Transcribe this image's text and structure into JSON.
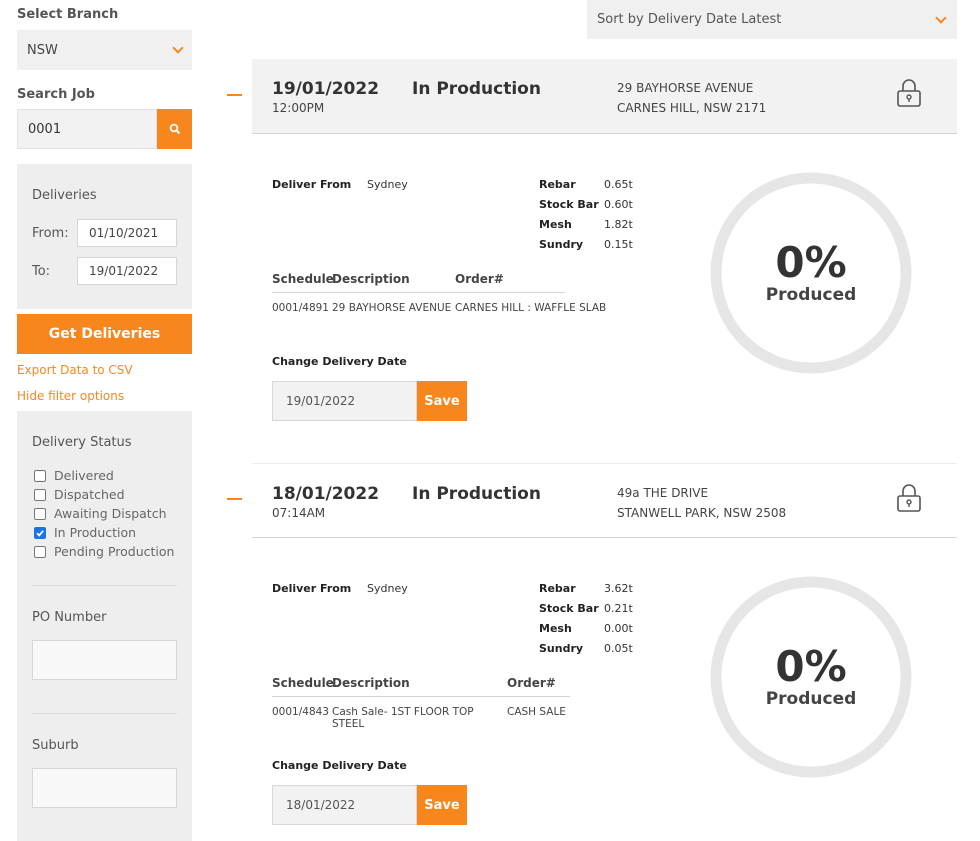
{
  "filters": {
    "branch_label": "Select Branch",
    "branch_value": "NSW",
    "search_label": "Search Job",
    "search_value": "0001",
    "deliveries_title": "Deliveries",
    "from_label": "From:",
    "from_value": "01/10/2021",
    "to_label": "To:",
    "to_value": "19/01/2022",
    "get_button": "Get Deliveries",
    "export_link": "Export Data to CSV",
    "hide_link": "Hide filter options",
    "status_title": "Delivery Status",
    "statuses": [
      {
        "label": "Delivered",
        "checked": false
      },
      {
        "label": "Dispatched",
        "checked": false
      },
      {
        "label": "Awaiting Dispatch",
        "checked": false
      },
      {
        "label": "In Production",
        "checked": true
      },
      {
        "label": "Pending Production",
        "checked": false
      }
    ],
    "po_label": "PO Number",
    "suburb_label": "Suburb"
  },
  "sort": {
    "label": "Sort by Delivery Date Latest"
  },
  "labels": {
    "deliver_from": "Deliver From",
    "schedule": "Schedule",
    "description": "Description",
    "order": "Order#",
    "change_date": "Change Delivery Date",
    "save": "Save",
    "produced": "Produced"
  },
  "jobs": [
    {
      "date": "19/01/2022",
      "time": "12:00PM",
      "status": "In Production",
      "address1": "29 BAYHORSE AVENUE",
      "address2": "CARNES HILL, NSW 2171",
      "deliver_from": "Sydney",
      "materials": [
        {
          "name": "Rebar",
          "value": "0.65t"
        },
        {
          "name": "Stock Bar",
          "value": "0.60t"
        },
        {
          "name": "Mesh",
          "value": "1.82t"
        },
        {
          "name": "Sundry",
          "value": "0.15t"
        }
      ],
      "schedule": "0001/4891",
      "description": "29 BAYHORSE AVENUE",
      "order": "CARNES HILL : WAFFLE SLAB",
      "delivery_date": "19/01/2022",
      "percent": "0%",
      "produced_fraction": 0
    },
    {
      "date": "18/01/2022",
      "time": "07:14AM",
      "status": "In Production",
      "address1": "49a THE DRIVE",
      "address2": "STANWELL PARK, NSW 2508",
      "deliver_from": "Sydney",
      "materials": [
        {
          "name": "Rebar",
          "value": "3.62t"
        },
        {
          "name": "Stock Bar",
          "value": "0.21t"
        },
        {
          "name": "Mesh",
          "value": "0.00t"
        },
        {
          "name": "Sundry",
          "value": "0.05t"
        }
      ],
      "schedule": "0001/4843",
      "description": "Cash Sale- 1ST FLOOR TOP STEEL",
      "order": "CASH SALE",
      "delivery_date": "18/01/2022",
      "percent": "0%",
      "produced_fraction": 0
    }
  ],
  "colors": {
    "accent": "#f7871d",
    "panel": "#eeeeee",
    "ring": "#e6e6e6"
  }
}
